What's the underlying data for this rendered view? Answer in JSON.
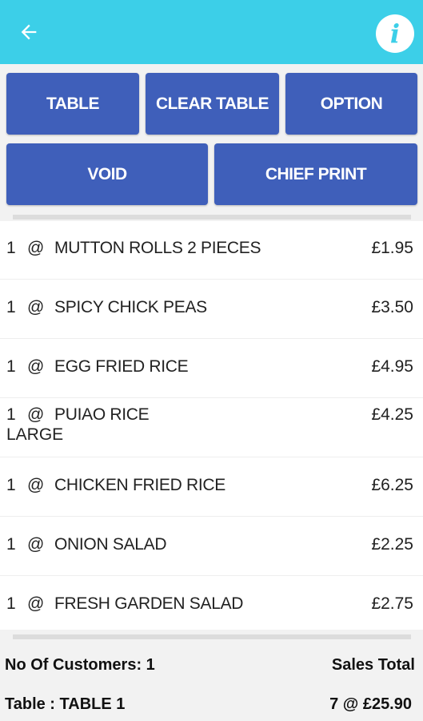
{
  "header": {
    "background": "#3ccfe8",
    "back_icon": "arrow-left-icon",
    "info_icon": "info-icon",
    "info_glyph": "i"
  },
  "actions": {
    "table": "TABLE",
    "clear_table": "CLEAR TABLE",
    "option": "OPTION",
    "void": "VOID",
    "chief_print": "CHIEF PRINT",
    "color": "#3f5fba"
  },
  "order": {
    "items": [
      {
        "qty": "1",
        "at": "@",
        "name": "MUTTON ROLLS 2 PIECES",
        "price": "£1.95",
        "modifier": ""
      },
      {
        "qty": "1",
        "at": "@",
        "name": "SPICY CHICK PEAS",
        "price": "£3.50",
        "modifier": ""
      },
      {
        "qty": "1",
        "at": "@",
        "name": "EGG FRIED RICE",
        "price": "£4.95",
        "modifier": ""
      },
      {
        "qty": "1",
        "at": "@",
        "name": "PUIAO RICE",
        "price": "£4.25",
        "modifier": "LARGE"
      },
      {
        "qty": "1",
        "at": "@",
        "name": "CHICKEN FRIED RICE",
        "price": "£6.25",
        "modifier": ""
      },
      {
        "qty": "1",
        "at": "@",
        "name": "ONION SALAD",
        "price": "£2.25",
        "modifier": ""
      },
      {
        "qty": "1",
        "at": "@",
        "name": "FRESH GARDEN SALAD",
        "price": "£2.75",
        "modifier": ""
      }
    ]
  },
  "summary": {
    "customers": "No Of Customers: 1",
    "sales_total_label": "Sales Total",
    "table": "Table : TABLE 1",
    "total": "7 @ £25.90"
  }
}
